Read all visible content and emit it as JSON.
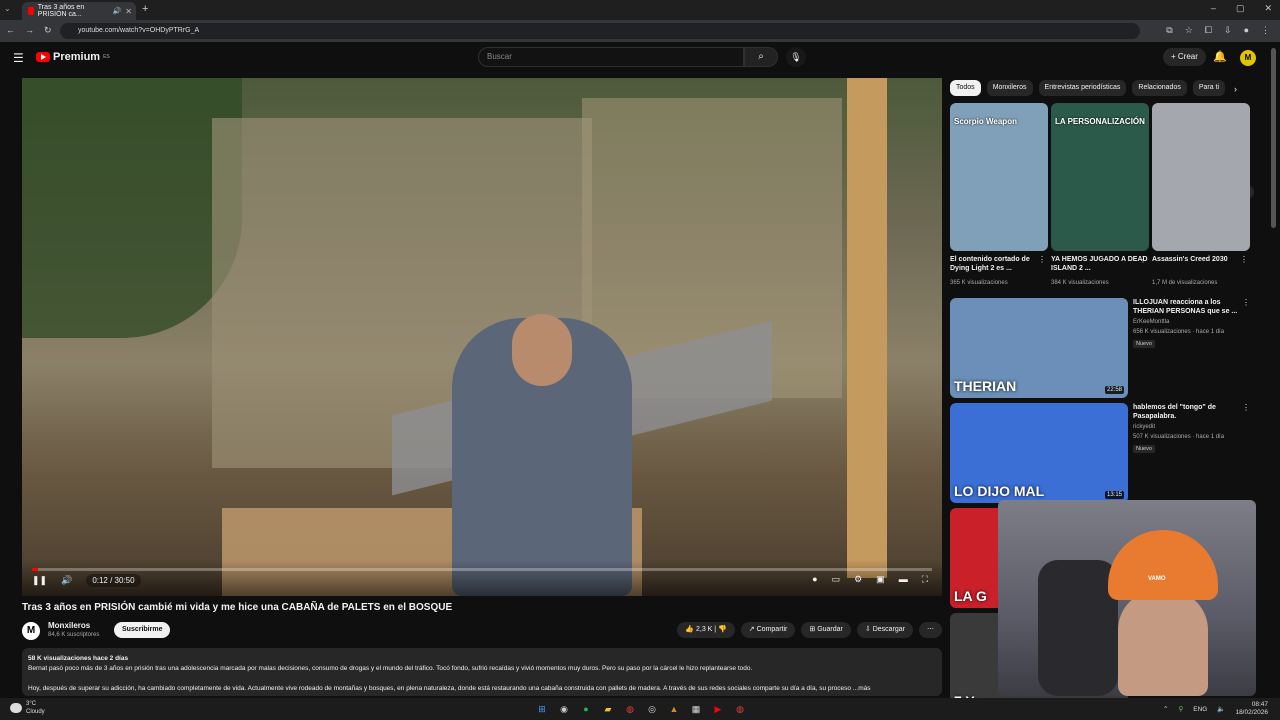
{
  "browser": {
    "tab_title": "Tras 3 años en PRISIÓN ca...",
    "url": "youtube.com/watch?v=OHDyPTRrG_A"
  },
  "header": {
    "logo_text": "Premium",
    "search_placeholder": "Buscar",
    "create_label": "Crear"
  },
  "video": {
    "time": "0:12 / 30:50",
    "progress_fraction": 0.0065,
    "title": "Tras 3 años en PRISIÓN cambié mi vida y me hice una CABAÑA de PALETS en el BOSQUE",
    "channel": "Monxileros",
    "subscribers": "84,6 K suscriptores",
    "subscribe_label": "Suscribirme",
    "likes": "2,3 K",
    "share_label": "Compartir",
    "save_label": "Guardar",
    "download_label": "Descargar",
    "desc_meta": "58 K visualizaciones  hace 2 días",
    "desc_line1": "Bernat pasó poco más de 3 años en prisión tras una adolescencia marcada por malas decisiones, consumo de drogas y el mundo del tráfico. Tocó fondo, sufrió recaídas y vivió momentos muy duros. Pero su paso por la cárcel le hizo replantearse todo.",
    "desc_line2": "Hoy, después de superar su adicción, ha cambiado completamente de vida. Actualmente vive rodeado de montañas y bosques, en plena naturaleza, donde está restaurando una cabaña construida con pallets de madera. A través de sus redes sociales comparte su día a día, su proceso ...más"
  },
  "chips": [
    "Todos",
    "Monxileros",
    "Entrevistas periodísticas",
    "Relacionados",
    "Para ti"
  ],
  "shorts": [
    {
      "caption": "Scorpio Weapon",
      "title": "El contenido cortado de Dying Light 2 es ...",
      "views": "365 K visualizaciones",
      "color": "#7fa0b8"
    },
    {
      "caption": "LA PERSONALIZACIÓN",
      "title": "YA HEMOS JUGADO A DEAD ISLAND 2 ...",
      "views": "384 K visualizaciones",
      "color": "#2c5a4a"
    },
    {
      "caption": "",
      "title": "Assassin's Creed 2030",
      "views": "1,7 M de visualizaciones",
      "color": "#a4a7ad"
    }
  ],
  "recommended": [
    {
      "title": "ILLOJUAN reacciona a los THERIAN PERSONAS que se ...",
      "channel": "ErKeeMonttla",
      "meta": "656 K visualizaciones · hace 1 día",
      "badge": "Nuevo",
      "duration": "22:58",
      "thumb_text": "THERIAN",
      "color": "#6b8fb8"
    },
    {
      "title": "hablemos del \"tongo\" de Pasapalabra.",
      "channel": "rickyedit",
      "meta": "507 K visualizaciones · hace 1 día",
      "badge": "Nuevo",
      "duration": "13:15",
      "thumb_text": "LO DIJO MAL",
      "color": "#3b6fd6"
    },
    {
      "title": "",
      "channel": "",
      "meta": "",
      "badge": "",
      "duration": "",
      "thumb_text": "LA G",
      "color": "#c9202a"
    },
    {
      "title": "",
      "channel": "",
      "meta": "",
      "badge": "",
      "duration": "",
      "thumb_text": "7 Y",
      "color": "#3a3a3a"
    }
  ],
  "webcam": {
    "hat_label": "VAMO"
  },
  "taskbar": {
    "temp": "3°C",
    "weather": "Cloudy",
    "lang": "ENG",
    "time": "08:47",
    "date": "18/02/2026"
  }
}
